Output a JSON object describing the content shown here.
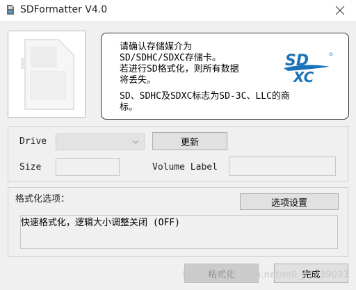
{
  "window": {
    "title": "SDFormatter V4.0",
    "icons": {
      "app": "sd-card-app-icon",
      "close": "close-icon"
    }
  },
  "info": {
    "message": "请确认存储媒介为\nSD/SDHC/SDXC存储卡。\n若进行SD格式化，则所有数据\n将丢失。",
    "note": "SD、SDHC及SDXC标志为SD-3C、LLC的商\n标。",
    "logo_top": "SD",
    "logo_bottom": "XC",
    "logo_color": "#1a73b8"
  },
  "drive": {
    "label": "Drive",
    "selected": "",
    "refresh_button": "更新"
  },
  "size": {
    "label": "Size",
    "value": ""
  },
  "volume_label": {
    "label": "Volume Label",
    "value": ""
  },
  "format_options": {
    "title": "格式化选项：",
    "settings_button": "选项设置",
    "summary": "快速格式化，逻辑大小调整关闭 (OFF)"
  },
  "footer": {
    "format_button": "格式化",
    "done_button": "完成",
    "watermark": "https://blog.csdn.net/m0_47739093"
  }
}
